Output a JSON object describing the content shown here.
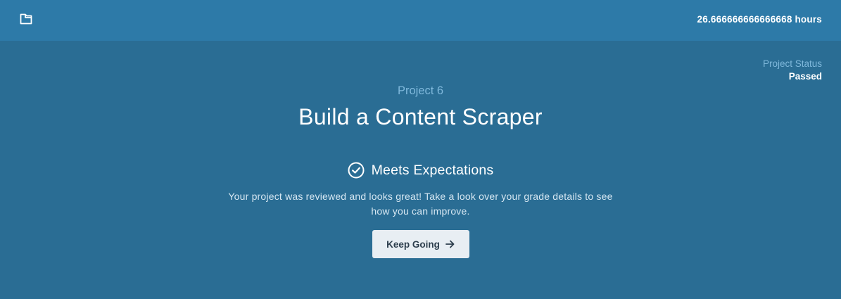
{
  "header": {
    "folder_icon": "folder-icon",
    "hours": "26.666666666666668 hours"
  },
  "status": {
    "label": "Project Status",
    "value": "Passed"
  },
  "project": {
    "number": "Project 6",
    "title": "Build a Content Scraper"
  },
  "result": {
    "icon": "check-circle-icon",
    "label": "Meets Expectations",
    "description_line1": "Your project was reviewed and looks great! Take a look over your grade details to see",
    "description_line2": "how you can improve."
  },
  "actions": {
    "keep_going_label": "Keep Going",
    "keep_going_icon": "arrow-right-icon"
  },
  "colors": {
    "topbar_bg": "#2d7aa8",
    "main_bg": "#2a6d94",
    "accent_text": "#7fb8db",
    "button_bg": "#e8eef3",
    "button_text": "#2d3e4d"
  }
}
